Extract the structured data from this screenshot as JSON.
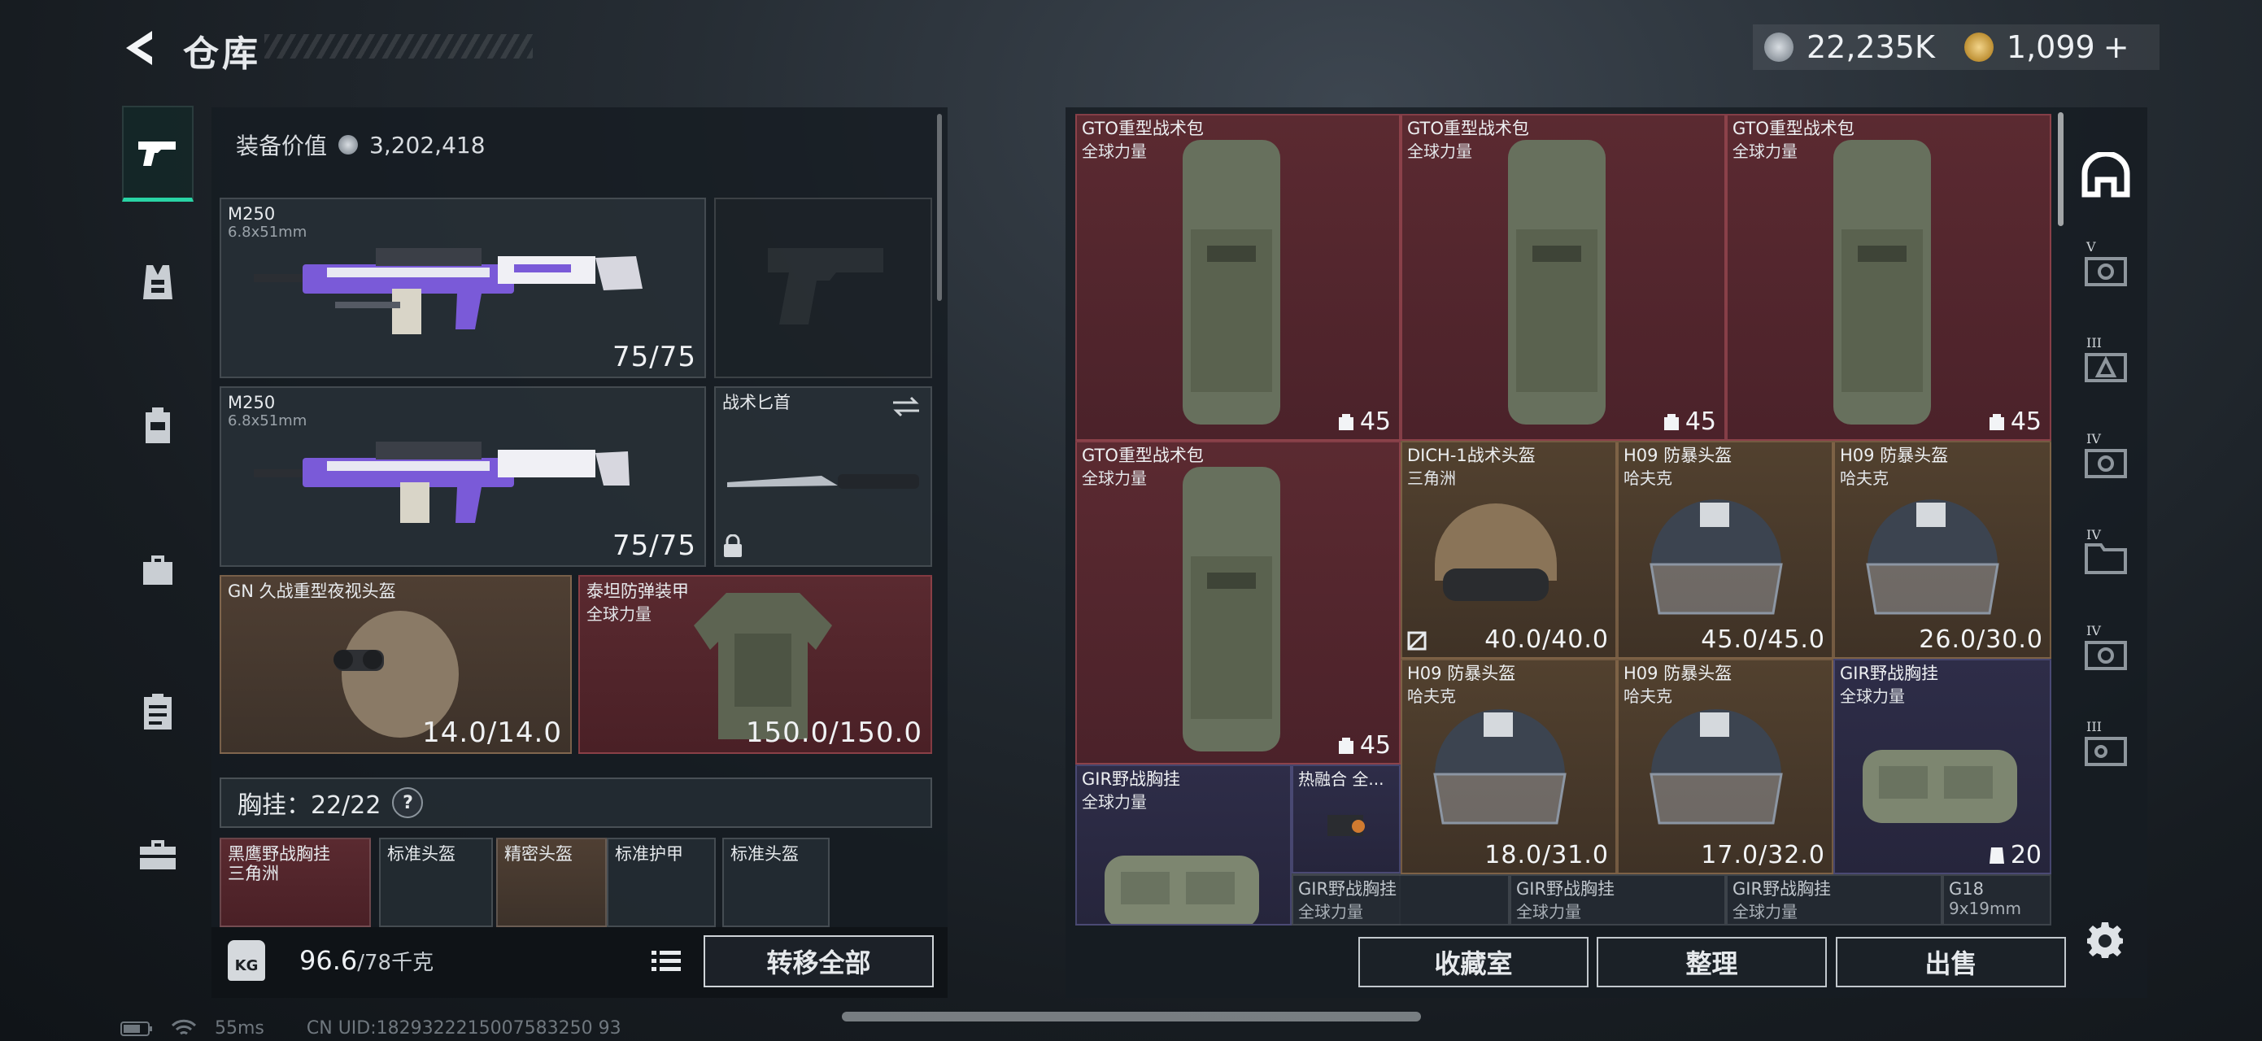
{
  "page": {
    "title": "仓库"
  },
  "currency": [
    {
      "icon": "silver-coin-icon",
      "value": "22,235K"
    },
    {
      "icon": "gold-coin-icon",
      "value": "1,099"
    }
  ],
  "add_currency": "+",
  "nav": [
    {
      "icon": "pistol-icon",
      "active": true
    },
    {
      "icon": "vest-icon"
    },
    {
      "icon": "backpack-icon"
    },
    {
      "icon": "bag-icon"
    },
    {
      "icon": "clipboard-icon"
    },
    {
      "icon": "toolbox-icon"
    }
  ],
  "equipment": {
    "value_label": "装备价值",
    "value": "3,202,418",
    "primary": {
      "name": "M250",
      "caliber": "6.8x51mm",
      "durability": "75/75"
    },
    "secondary": {
      "name": "M250",
      "caliber": "6.8x51mm",
      "durability": "75/75"
    },
    "knife": {
      "name": "战术匕首"
    },
    "helmet": {
      "name": "GN 久战重型夜视头盔",
      "durability": "14.0/14.0"
    },
    "armor": {
      "name": "泰坦防弹装甲",
      "brand": "全球力量",
      "durability": "150.0/150.0"
    },
    "chest_label": "胸挂：22/22",
    "help": "?",
    "chest_items": [
      {
        "name": "黑鹰野战胸挂",
        "sub": "三角洲"
      },
      {
        "name": "标准头盔"
      },
      {
        "name": "精密头盔"
      },
      {
        "name": "标准护甲"
      },
      {
        "name": "标准头盔"
      }
    ]
  },
  "weight": {
    "kg_label": "KG",
    "value": "96.6",
    "unit": "/78千克"
  },
  "transfer_all": "转移全部",
  "stash": {
    "items": [
      {
        "name": "GTO重型战术包",
        "brand": "全球力量",
        "capacity": "45"
      },
      {
        "name": "GTO重型战术包",
        "brand": "全球力量",
        "capacity": "45"
      },
      {
        "name": "GTO重型战术包",
        "brand": "全球力量",
        "capacity": "45"
      },
      {
        "name": "GTO重型战术包",
        "brand": "全球力量",
        "capacity": "45"
      },
      {
        "name": "DICH-1战术头盔",
        "brand": "三角洲",
        "durability": "40.0/40.0"
      },
      {
        "name": "H09 防暴头盔",
        "brand": "哈夫克",
        "durability": "45.0/45.0"
      },
      {
        "name": "H09 防暴头盔",
        "brand": "哈夫克",
        "durability": "26.0/30.0"
      },
      {
        "name": "H09 防暴头盔",
        "brand": "哈夫克",
        "durability": "18.0/31.0"
      },
      {
        "name": "H09 防暴头盔",
        "brand": "哈夫克",
        "durability": "17.0/32.0"
      },
      {
        "name": "GIR野战胸挂",
        "brand": "全球力量",
        "capacity": "20"
      },
      {
        "name": "GIR野战胸挂",
        "brand": "全球力量"
      },
      {
        "name": "热融合 全..."
      },
      {
        "name": "GIR野战胸挂",
        "brand": "全球力量"
      },
      {
        "name": "GIR野战胸挂",
        "brand": "全球力量"
      },
      {
        "name": "GIR野战胸挂",
        "brand": "全球力量"
      },
      {
        "name": "G18",
        "brand": "9x19mm"
      }
    ]
  },
  "footer": {
    "collection": "收藏室",
    "sort": "整理",
    "sell": "出售"
  },
  "side_levels": [
    "V",
    "III",
    "IV",
    "IV",
    "IV",
    "III"
  ],
  "status": {
    "ping": "55ms",
    "uid": "CN UID:1829322215007583250 93"
  },
  "colors": {
    "accent": "#29d4a5",
    "red_rarity": "#5b2a31",
    "gold_rarity": "#52412f",
    "purple_rarity": "#2e2d48"
  }
}
